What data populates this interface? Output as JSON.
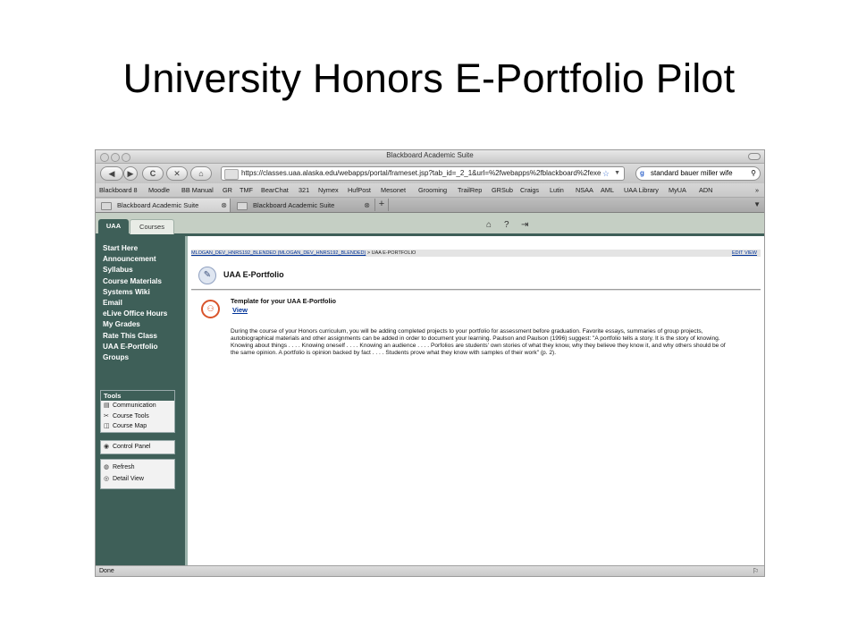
{
  "slide": {
    "title": "University Honors E-Portfolio Pilot"
  },
  "window": {
    "title": "Blackboard Academic Suite"
  },
  "toolbar": {
    "back": "◀",
    "forward": "▶",
    "reload": "C",
    "stop": "✕",
    "home": "⌂",
    "url": "https://classes.uaa.alaska.edu/webapps/portal/frameset.jsp?tab_id=_2_1&url=%2fwebapps%2fblackboard%2fexe",
    "search_value": "standard bauer miller wife"
  },
  "bookmarks": [
    "Blackboard 8",
    "Moodle",
    "BB Manual",
    "GR",
    "TMF",
    "BearChat",
    "321",
    "Nymex",
    "HufPost",
    "Mesonet",
    "Grooming",
    "TrailRep",
    "GRSub",
    "Craigs",
    "Lutin",
    "NSAA",
    "AML",
    "UAA Library",
    "MyUA",
    "ADN"
  ],
  "bookmarks_more": "»",
  "tabs": [
    {
      "label": "Blackboard Academic Suite"
    },
    {
      "label": "Blackboard Academic Suite"
    }
  ],
  "bb": {
    "tabs": [
      "UAA",
      "Courses"
    ],
    "icons": [
      "home-icon",
      "help-icon",
      "logout-icon"
    ]
  },
  "sidebar": {
    "menu": [
      "Start Here",
      "Announcement",
      "Syllabus",
      "Course Materials",
      "Systems Wiki",
      "Email",
      "eLive Office Hours",
      "My Grades",
      "Rate This Class",
      "UAA E-Portfolio",
      "Groups"
    ],
    "tools_title": "Tools",
    "tools": [
      "Communication",
      "Course Tools",
      "Course Map"
    ],
    "control_panel": "Control Panel",
    "refresh": "Refresh",
    "detail_view": "Detail View"
  },
  "content": {
    "breadcrumb_link": "MLOGAN_DEV_HNRS192_BLENDED (MLOGAN_DEV_HNRS192_BLENDED)",
    "breadcrumb_current": " > UAA E-PORTFOLIO",
    "edit_view": "EDIT VIEW",
    "page_title": "UAA E-Portfolio",
    "item_title": "Template for your UAA E-Portfolio",
    "item_link": "View",
    "description": "During the course of your Honors curriculum, you will be adding completed projects to your portfolio for assessment before graduation. Favorite essays, summaries of group projects, autobiographical materials and other assignments can be added in order to document your learning. Paulson and Paulson (1996) suggest: \"A portfolio tells a story. It is the story of knowing. Knowing about things . . . . Knowing oneself . . . . Knowing an audience . . . . Porfolios are students' own stories of what they know, why they believe they know it, and why others should be of the same opinion. A portfolio is opinion backed by fact . . . . Students prove what they know with samples of their work\" (p. 2)."
  },
  "status": {
    "text": "Done"
  }
}
